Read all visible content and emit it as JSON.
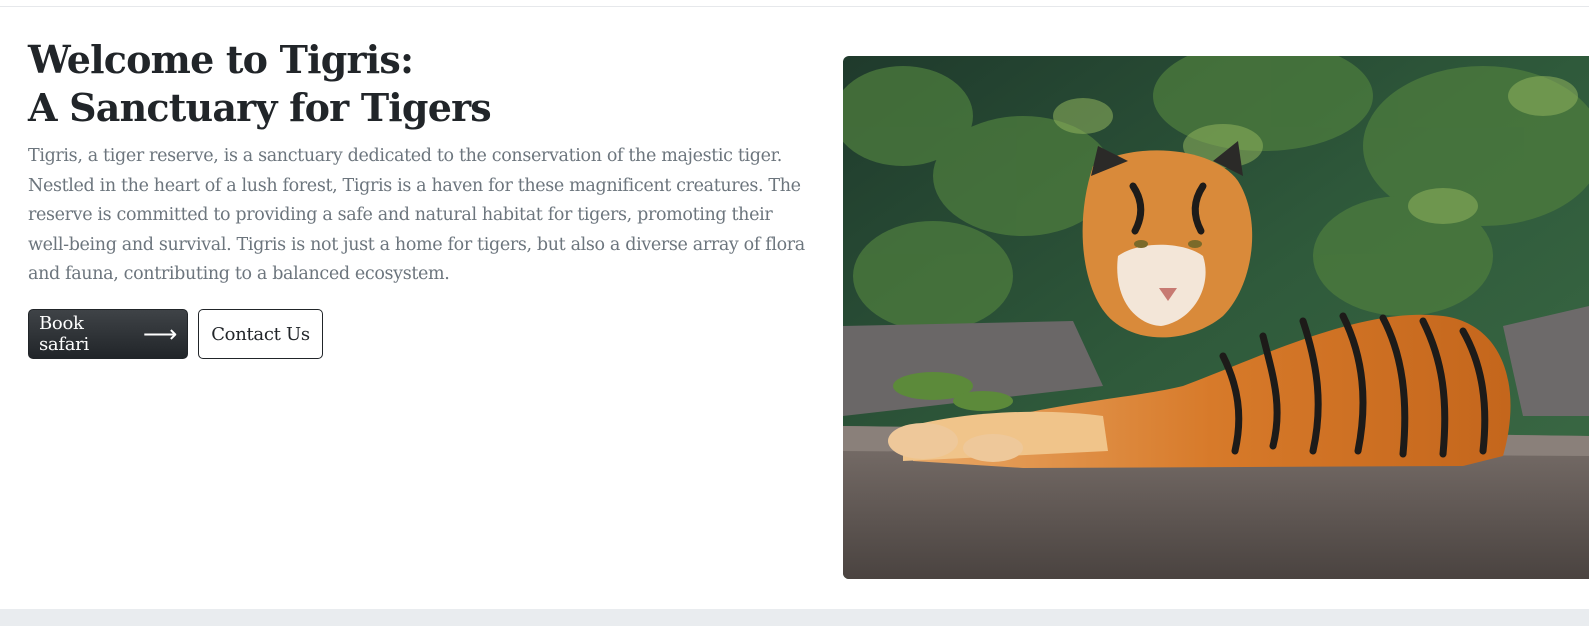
{
  "hero": {
    "title_line1": "Welcome to Tigris:",
    "title_line2": "A Sanctuary for Tigers",
    "description": "Tigris, a tiger reserve, is a sanctuary dedicated to the conservation of the majestic tiger. Nestled in the heart of a lush forest, Tigris is a haven for these magnificent creatures. The reserve is committed to providing a safe and natural habitat for tigers, promoting their well-being and survival. Tigris is not just a home for tigers, but also a diverse array of flora and fauna, contributing to a balanced ecosystem.",
    "primary_button_label": "Book safari",
    "primary_button_icon": "arrow-right-icon",
    "secondary_button_label": "Contact Us"
  },
  "colors": {
    "heading": "#212529",
    "body_text": "#6c757d",
    "primary_button": "#212529",
    "page_background": "#ffffff",
    "footer_band": "#e9ecef"
  },
  "image": {
    "subject": "tiger-photo"
  }
}
